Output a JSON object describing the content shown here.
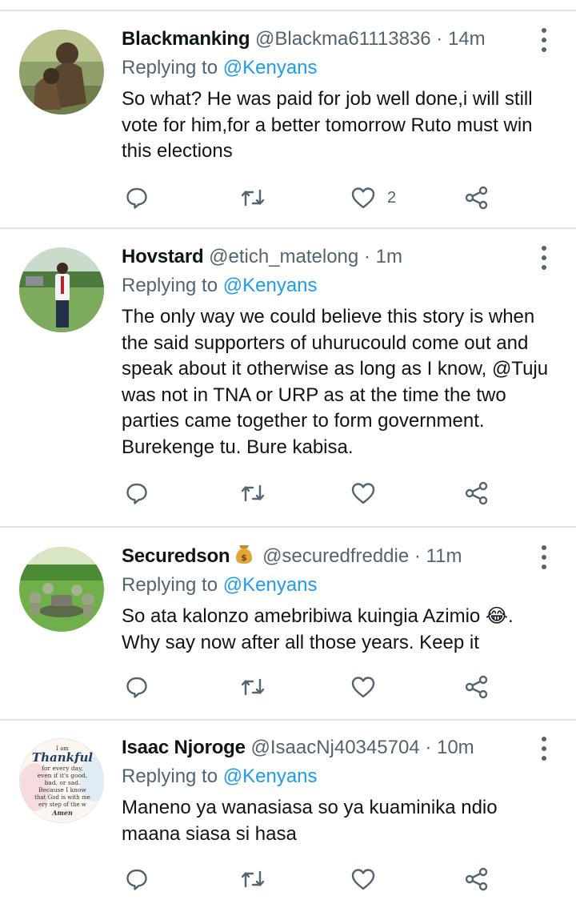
{
  "reply_prefix": "Replying to",
  "tweets": [
    {
      "name": "Blackmanking",
      "emoji": "",
      "handle": "@Blackma61113836",
      "sep": "·",
      "time": "14m",
      "replying_to": "@Kenyans",
      "text": "So what? He was paid for job well done,i will still vote for him,for a better tomorrow Ruto must win this elections",
      "likes": "2",
      "avatar": "bronze-statue-photo"
    },
    {
      "name": "Hovstard",
      "emoji": "",
      "handle": "@etich_matelong",
      "sep": "·",
      "time": "1m",
      "replying_to": "@Kenyans",
      "text": "The only way we could believe this story is when the said supporters of uhurucould come out and speak about it otherwise as long as I know, @Tuju was not in TNA or URP as at the time the two parties came together to form government. Burekenge tu. Bure kabisa.",
      "likes": "",
      "avatar": "man-standing-on-lawn-photo"
    },
    {
      "name": "Securedson",
      "emoji": "money-bag-emoji",
      "handle": "@securedfreddie",
      "sep": "·",
      "time": "11m",
      "replying_to": "@Kenyans",
      "text": "So ata kalonzo amebribiwa kuingia Azimio 😂.\nWhy say now after all those years. Keep it",
      "likes": "",
      "avatar": "frog-statues-photo"
    },
    {
      "name": "Isaac Njoroge",
      "emoji": "",
      "handle": "@IsaacNj40345704",
      "sep": "·",
      "time": "10m",
      "replying_to": "@Kenyans",
      "text": "Maneno ya wanasiasa so ya kuaminika ndio maana siasa si hasa",
      "likes": "",
      "avatar": "thankful-quote-image",
      "avatar_text": [
        "I am",
        "Thankful",
        "for every day,",
        "even if it's good,",
        "bad, or sad.",
        "Because I know",
        "that God is with me",
        "ery step of the w",
        "Amen"
      ]
    }
  ],
  "colors": {
    "text": "#0f1419",
    "secondary": "#536471",
    "link": "#1d9bf0",
    "divider": "#e1e5e9"
  }
}
